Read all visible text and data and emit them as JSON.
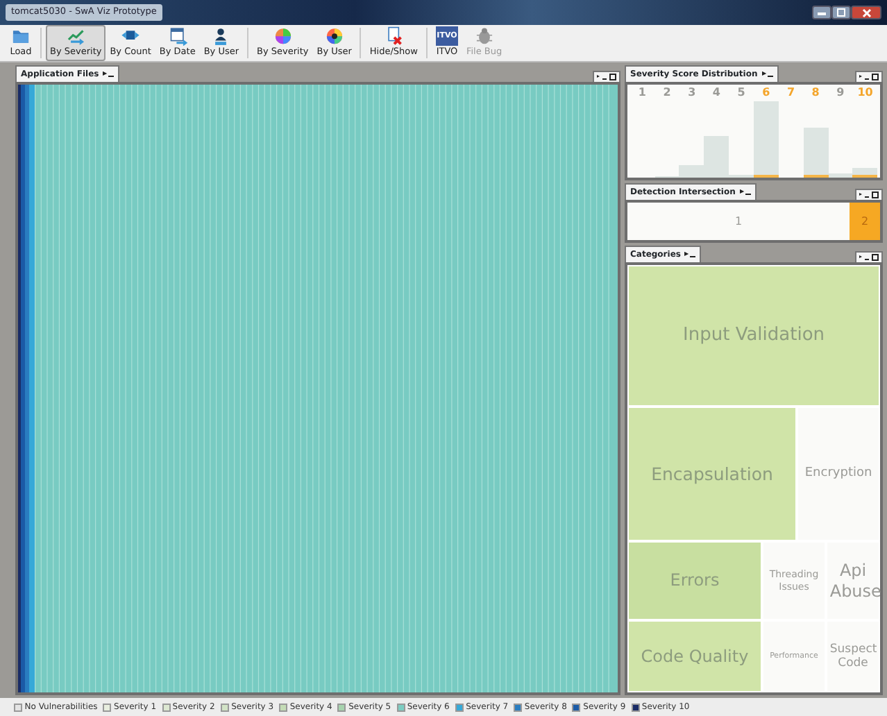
{
  "window": {
    "title": "tomcat5030 - SwA Viz Prototype"
  },
  "toolbar": [
    [
      {
        "label": "Load",
        "selected": false,
        "disabled": false
      }
    ],
    [
      {
        "label": "By Severity",
        "selected": true,
        "disabled": false
      },
      {
        "label": "By Count",
        "selected": false,
        "disabled": false
      },
      {
        "label": "By Date",
        "selected": false,
        "disabled": false
      },
      {
        "label": "By User",
        "selected": false,
        "disabled": false
      }
    ],
    [
      {
        "label": "By Severity",
        "selected": false,
        "disabled": false
      },
      {
        "label": "By User",
        "selected": false,
        "disabled": false
      }
    ],
    [
      {
        "label": "Hide/Show",
        "selected": false,
        "disabled": false
      }
    ],
    [
      {
        "label": "ITVO",
        "selected": false,
        "disabled": false
      },
      {
        "label": "File Bug",
        "selected": false,
        "disabled": true
      }
    ]
  ],
  "itvo_icon_text": "ITVO",
  "application_files": {
    "title": "Application Files"
  },
  "severity_distribution": {
    "title": "Severity Score Distribution",
    "scores": [
      {
        "label": "1",
        "highlighted": false
      },
      {
        "label": "2",
        "highlighted": false
      },
      {
        "label": "3",
        "highlighted": false
      },
      {
        "label": "4",
        "highlighted": false
      },
      {
        "label": "5",
        "highlighted": false
      },
      {
        "label": "6",
        "highlighted": true
      },
      {
        "label": "7",
        "highlighted": true
      },
      {
        "label": "8",
        "highlighted": true
      },
      {
        "label": "9",
        "highlighted": false
      },
      {
        "label": "10",
        "highlighted": true
      }
    ]
  },
  "detection_intersection": {
    "title": "Detection Intersection",
    "cells": [
      {
        "label": "1",
        "selected": false
      },
      {
        "label": "2",
        "selected": true
      }
    ]
  },
  "categories": {
    "title": "Categories",
    "items": [
      {
        "label": "Input Validation",
        "active": true
      },
      {
        "label": "Encapsulation",
        "active": true
      },
      {
        "label": "Encryption",
        "active": false
      },
      {
        "label": "Errors",
        "active": true
      },
      {
        "label": "Threading Issues",
        "active": false
      },
      {
        "label": "Api Abuse",
        "active": false
      },
      {
        "label": "Code Quality",
        "active": true
      },
      {
        "label": "Performance",
        "active": false
      },
      {
        "label": "Suspect Code",
        "active": false
      }
    ]
  },
  "legend": [
    {
      "label": "No Vulnerabilities",
      "color": "#e4e4e4"
    },
    {
      "label": "Severity 1",
      "color": "#e8eedf"
    },
    {
      "label": "Severity 2",
      "color": "#dde8d2"
    },
    {
      "label": "Severity 3",
      "color": "#d2e3c6"
    },
    {
      "label": "Severity 4",
      "color": "#c4dcb6"
    },
    {
      "label": "Severity 5",
      "color": "#a6d3ae"
    },
    {
      "label": "Severity 6",
      "color": "#7ccdc2"
    },
    {
      "label": "Severity 7",
      "color": "#36a9d8"
    },
    {
      "label": "Severity 8",
      "color": "#2a7dc0"
    },
    {
      "label": "Severity 9",
      "color": "#1b5aa6"
    },
    {
      "label": "Severity 10",
      "color": "#1a2c66"
    }
  ]
}
